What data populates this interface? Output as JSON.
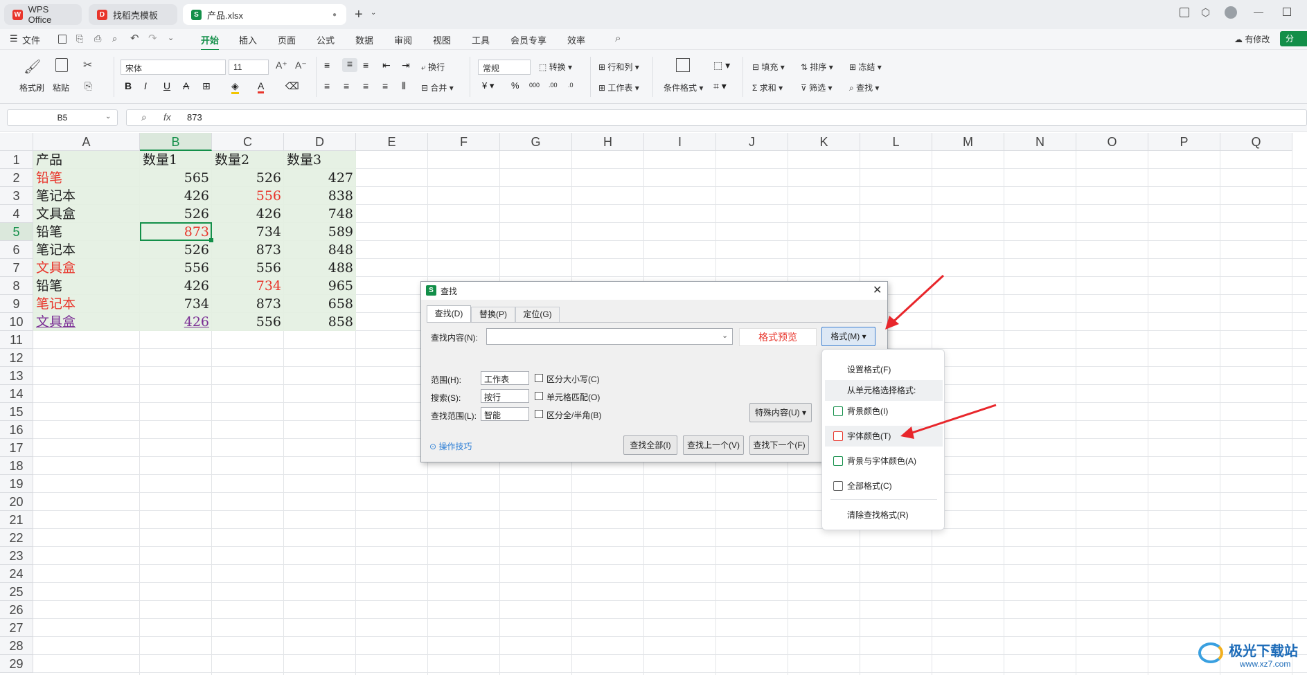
{
  "tabs": [
    {
      "label": "WPS Office",
      "icon": "wps-logo-icon"
    },
    {
      "label": "找稻壳模板",
      "icon": "docer-icon"
    },
    {
      "label": "产品.xlsx",
      "icon": "spreadsheet-icon"
    }
  ],
  "menu": [
    "文件",
    "开始",
    "插入",
    "页面",
    "公式",
    "数据",
    "审阅",
    "视图",
    "工具",
    "会员专享",
    "效率"
  ],
  "menu_active": "开始",
  "top_right": {
    "modified": "有修改",
    "share": "分"
  },
  "ribbon": {
    "format_painter": "格式刷",
    "paste": "粘贴",
    "font_name": "宋体",
    "font_size": "11",
    "wrap": "换行",
    "merge": "合并",
    "number_format": "常规",
    "convert": "转换",
    "row_col": "行和列",
    "worksheet": "工作表",
    "cond_format": "条件格式",
    "fill": "填充",
    "sort": "排序",
    "freeze": "冻结",
    "sum": "求和",
    "filter": "筛选",
    "find": "查找"
  },
  "formula_bar": {
    "cell_ref": "B5",
    "fx": "fx",
    "value": "873"
  },
  "columns": [
    "A",
    "B",
    "C",
    "D",
    "E",
    "F",
    "G",
    "H",
    "I",
    "J",
    "K",
    "L",
    "M",
    "N",
    "O",
    "P",
    "Q"
  ],
  "rows": [
    "1",
    "2",
    "3",
    "4",
    "5",
    "6",
    "7",
    "8",
    "9",
    "10",
    "11",
    "12",
    "13",
    "14",
    "15",
    "16",
    "17",
    "18",
    "19",
    "20",
    "21",
    "22",
    "23",
    "24",
    "25",
    "26",
    "27",
    "28",
    "29"
  ],
  "sheet": {
    "header": [
      "产品",
      "数量1",
      "数量2",
      "数量3"
    ],
    "data": [
      [
        "铅笔",
        "565",
        "526",
        "427"
      ],
      [
        "笔记本",
        "426",
        "556",
        "838"
      ],
      [
        "文具盒",
        "526",
        "426",
        "748"
      ],
      [
        "铅笔",
        "873",
        "734",
        "589"
      ],
      [
        "笔记本",
        "526",
        "873",
        "848"
      ],
      [
        "文具盒",
        "556",
        "556",
        "488"
      ],
      [
        "铅笔",
        "426",
        "734",
        "965"
      ],
      [
        "笔记本",
        "734",
        "873",
        "658"
      ],
      [
        "文具盒",
        "426",
        "556",
        "858"
      ]
    ],
    "colors": {
      "red": "#e8352b",
      "purple": "#7a2d94",
      "fill": "#e3f0e1",
      "normal": "#222222"
    }
  },
  "dialog": {
    "title": "查找",
    "tabs": [
      "查找(D)",
      "替换(P)",
      "定位(G)"
    ],
    "find_label": "查找内容(N):",
    "find_value": "",
    "preview": "格式预览",
    "format_btn": "格式(M)",
    "scope_label": "范围(H):",
    "scope_value": "工作表",
    "search_label": "搜索(S):",
    "search_value": "按行",
    "range_label": "查找范围(L):",
    "range_value": "智能",
    "case": "区分大小写(C)",
    "whole": "单元格匹配(O)",
    "width": "区分全/半角(B)",
    "special": "特殊内容(U)",
    "tips": "操作技巧",
    "find_all": "查找全部(I)",
    "find_prev": "查找上一个(V)",
    "find_next": "查找下一个(F)"
  },
  "format_menu": {
    "set_format": "设置格式(F)",
    "from_cell": "从单元格选择格式:",
    "bg_color": "背景颜色(I)",
    "font_color": "字体颜色(T)",
    "bg_font_color": "背景与字体颜色(A)",
    "all_format": "全部格式(C)",
    "clear": "清除查找格式(R)"
  },
  "watermark": {
    "name": "极光下载站",
    "url": "www.xz7.com"
  }
}
